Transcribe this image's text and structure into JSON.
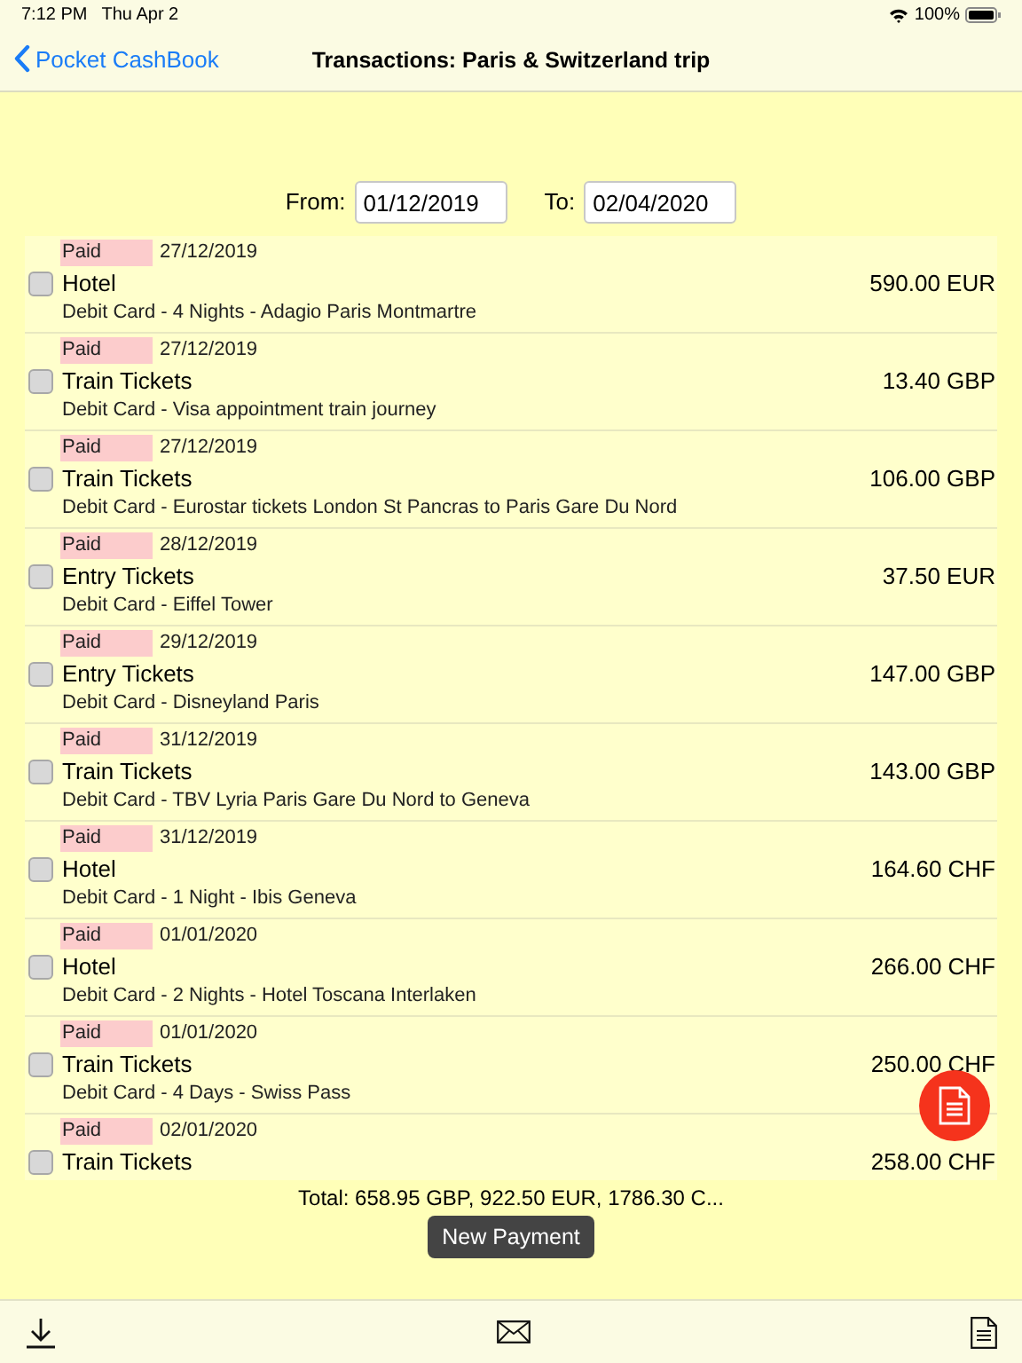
{
  "status_bar": {
    "time": "7:12 PM",
    "date": "Thu Apr 2",
    "battery": "100%"
  },
  "nav": {
    "back": "Pocket CashBook",
    "title": "Transactions: Paris & Switzerland trip"
  },
  "filter": {
    "from_label": "From:",
    "from": "01/12/2019",
    "to_label": "To:",
    "to": "02/04/2020"
  },
  "transactions": [
    {
      "status": "Paid",
      "date": "27/12/2019",
      "checked": false,
      "category": "Hotel",
      "amount": "590.00 EUR",
      "details": "Debit Card - 4 Nights - Adagio Paris Montmartre"
    },
    {
      "status": "Paid",
      "date": "27/12/2019",
      "checked": false,
      "category": "Train Tickets",
      "amount": "13.40 GBP",
      "details": "Debit Card - Visa appointment train journey"
    },
    {
      "status": "Paid",
      "date": "27/12/2019",
      "checked": false,
      "category": "Train Tickets",
      "amount": "106.00 GBP",
      "details": "Debit Card - Eurostar tickets London St Pancras to Paris Gare Du Nord"
    },
    {
      "status": "Paid",
      "date": "28/12/2019",
      "checked": false,
      "category": "Entry Tickets",
      "amount": "37.50 EUR",
      "details": "Debit Card - Eiffel Tower"
    },
    {
      "status": "Paid",
      "date": "29/12/2019",
      "checked": false,
      "category": "Entry Tickets",
      "amount": "147.00 GBP",
      "details": "Debit Card - Disneyland Paris"
    },
    {
      "status": "Paid",
      "date": "31/12/2019",
      "checked": false,
      "category": "Train Tickets",
      "amount": "143.00 GBP",
      "details": "Debit Card - TBV Lyria Paris Gare Du Nord to Geneva"
    },
    {
      "status": "Paid",
      "date": "31/12/2019",
      "checked": false,
      "category": "Hotel",
      "amount": "164.60 CHF",
      "details": "Debit Card - 1 Night - Ibis Geneva"
    },
    {
      "status": "Paid",
      "date": "01/01/2020",
      "checked": false,
      "category": "Hotel",
      "amount": "266.00 CHF",
      "details": "Debit Card - 2 Nights - Hotel Toscana Interlaken"
    },
    {
      "status": "Paid",
      "date": "01/01/2020",
      "checked": false,
      "category": "Train Tickets",
      "amount": "250.00 CHF",
      "details": "Debit Card - 4 Days - Swiss Pass"
    },
    {
      "status": "Paid",
      "date": "02/01/2020",
      "checked": false,
      "category": "Train Tickets",
      "amount": "258.00 CHF"
    }
  ],
  "total": "Total: 658.95 GBP, 922.50 EUR, 1786.30 C...",
  "new_button": "New Payment"
}
